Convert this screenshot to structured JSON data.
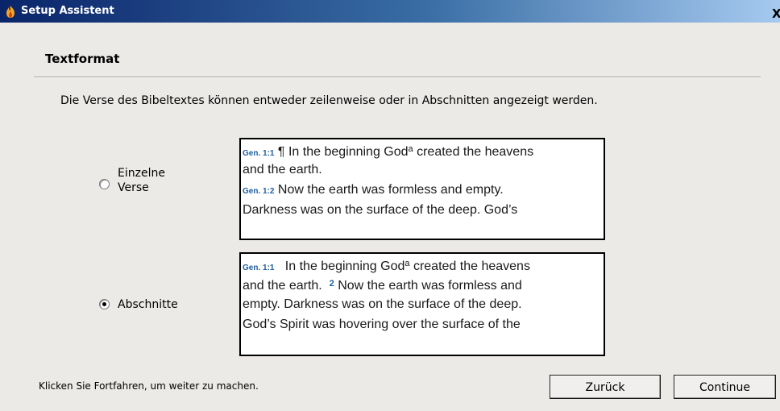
{
  "window": {
    "title": "Setup Assistent",
    "close_label": "X"
  },
  "section": {
    "title": "Textformat",
    "description": "Die Verse des Bibeltextes können entweder zeilenweise oder in Abschnitten angezeigt werden."
  },
  "options": {
    "verses": {
      "label_line1": "Einzelne",
      "label_line2": "Verse",
      "selected": false
    },
    "paragraphs": {
      "label": "Abschnitte",
      "selected": true
    }
  },
  "preview_verses": {
    "line1_ref": "Gen. 1:1",
    "line1_pilcrow": "¶",
    "line1_text_a": " In the beginning God",
    "line1_sup": "a",
    "line1_text_b": " created the heavens",
    "line2": "and the earth.",
    "line3_ref": "Gen. 1:2",
    "line3_text": " Now the earth was formless and empty.",
    "line4": "Darkness was on the surface of the deep. God’s"
  },
  "preview_paragraphs": {
    "line1_ref": "Gen. 1:1",
    "line1_text_a": "   In the beginning God",
    "line1_sup": "a",
    "line1_text_b": " created the heavens",
    "line2_text_a": "and the earth.  ",
    "line2_verse_num": "2",
    "line2_text_b": " Now the earth was formless and",
    "line3": "empty. Darkness was on the surface of the deep.",
    "line4": "God’s Spirit was hovering over the surface of the"
  },
  "footer": {
    "hint": "Klicken Sie Fortfahren, um weiter zu machen.",
    "back_label": "Zurück",
    "continue_label": "Continue"
  }
}
